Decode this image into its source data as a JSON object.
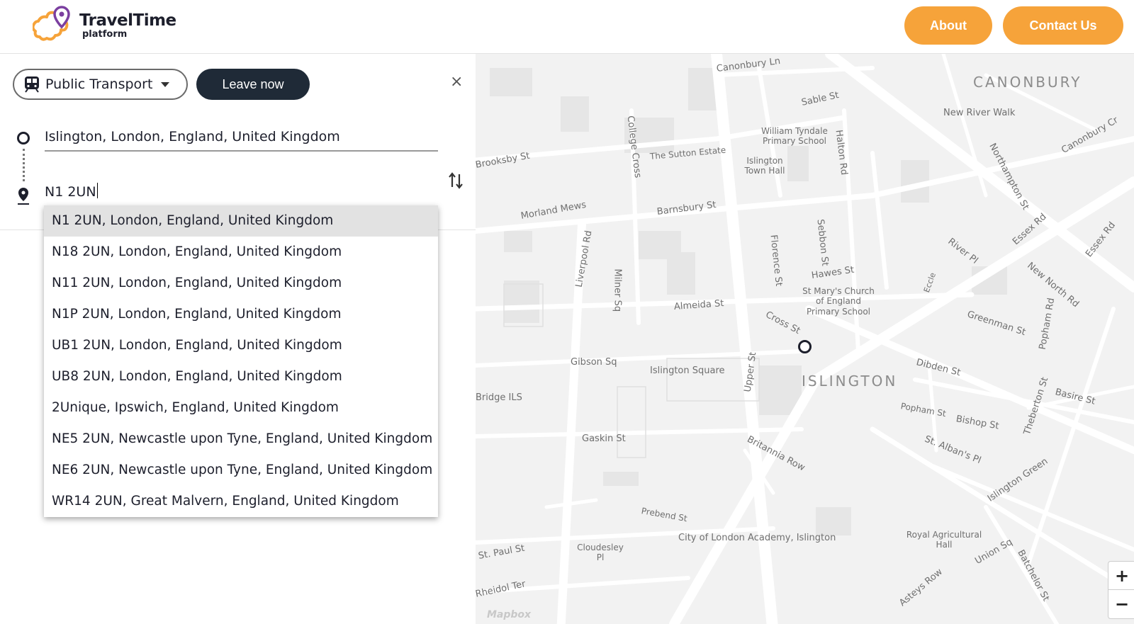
{
  "header": {
    "logo_title": "TravelTime",
    "logo_sub": "platform",
    "about_label": "About",
    "contact_label": "Contact Us",
    "accent_color": "#f6a33a"
  },
  "search": {
    "mode_label": "Public Transport",
    "mode_icon": "train-icon",
    "leave_label": "Leave now",
    "close_glyph": "×",
    "origin_value": "Islington, London, England, United Kingdom",
    "destination_value": "N1 2UN",
    "suggestions": [
      "N1 2UN, London, England, United Kingdom",
      "N18 2UN, London, England, United Kingdom",
      "N11 2UN, London, England, United Kingdom",
      "N1P 2UN, London, England, United Kingdom",
      "UB1 2UN, London, England, United Kingdom",
      "UB8 2UN, London, England, United Kingdom",
      "2Unique, Ipswich, England, United Kingdom",
      "NE5 2UN, Newcastle upon Tyne, England, United Kingdom",
      "NE6 2UN, Newcastle upon Tyne, England, United Kingdom",
      "WR14 2UN, Great Malvern, England, United Kingdom"
    ]
  },
  "map": {
    "areas": [
      "CANONBURY",
      "ISLINGTON"
    ],
    "streets": [
      "Canonbury Ln",
      "Sable St",
      "Halton Rd",
      "New River Walk",
      "Northampton St",
      "Canonbury Cr",
      "Brooksby St",
      "College Cross",
      "The Sutton Estate",
      "William Tyndale Primary School",
      "Islington Town Hall",
      "Morland Mews",
      "Barnsbury St",
      "Essex Rd",
      "River Pl",
      "Sebbon St",
      "Florence St",
      "Liverpool Rd",
      "Milner Sq",
      "Hawes St",
      "St Mary's Church of England Primary School",
      "New North Rd",
      "Almeida St",
      "Cross St",
      "Greenman St",
      "Popham Rd",
      "Gibson Sq",
      "Islington Square",
      "Upper St",
      "Dibden St",
      "Basire St",
      "Bridge ILS",
      "Popham St",
      "Bishop St",
      "Theberton St",
      "Gaskin St",
      "Britannia Row",
      "St. Alban's Pl",
      "Prebend St",
      "Islington Green",
      "City of London Academy, Islington",
      "Royal Agricultural Hall",
      "Cloudesley Pl",
      "St. Paul St",
      "Union Sq",
      "Batchelor St",
      "Rheidol Ter",
      "Asteys Row",
      "Eccle",
      "Essex Rd"
    ],
    "zoom_in": "+",
    "zoom_out": "−",
    "attribution": "Mapbox"
  }
}
